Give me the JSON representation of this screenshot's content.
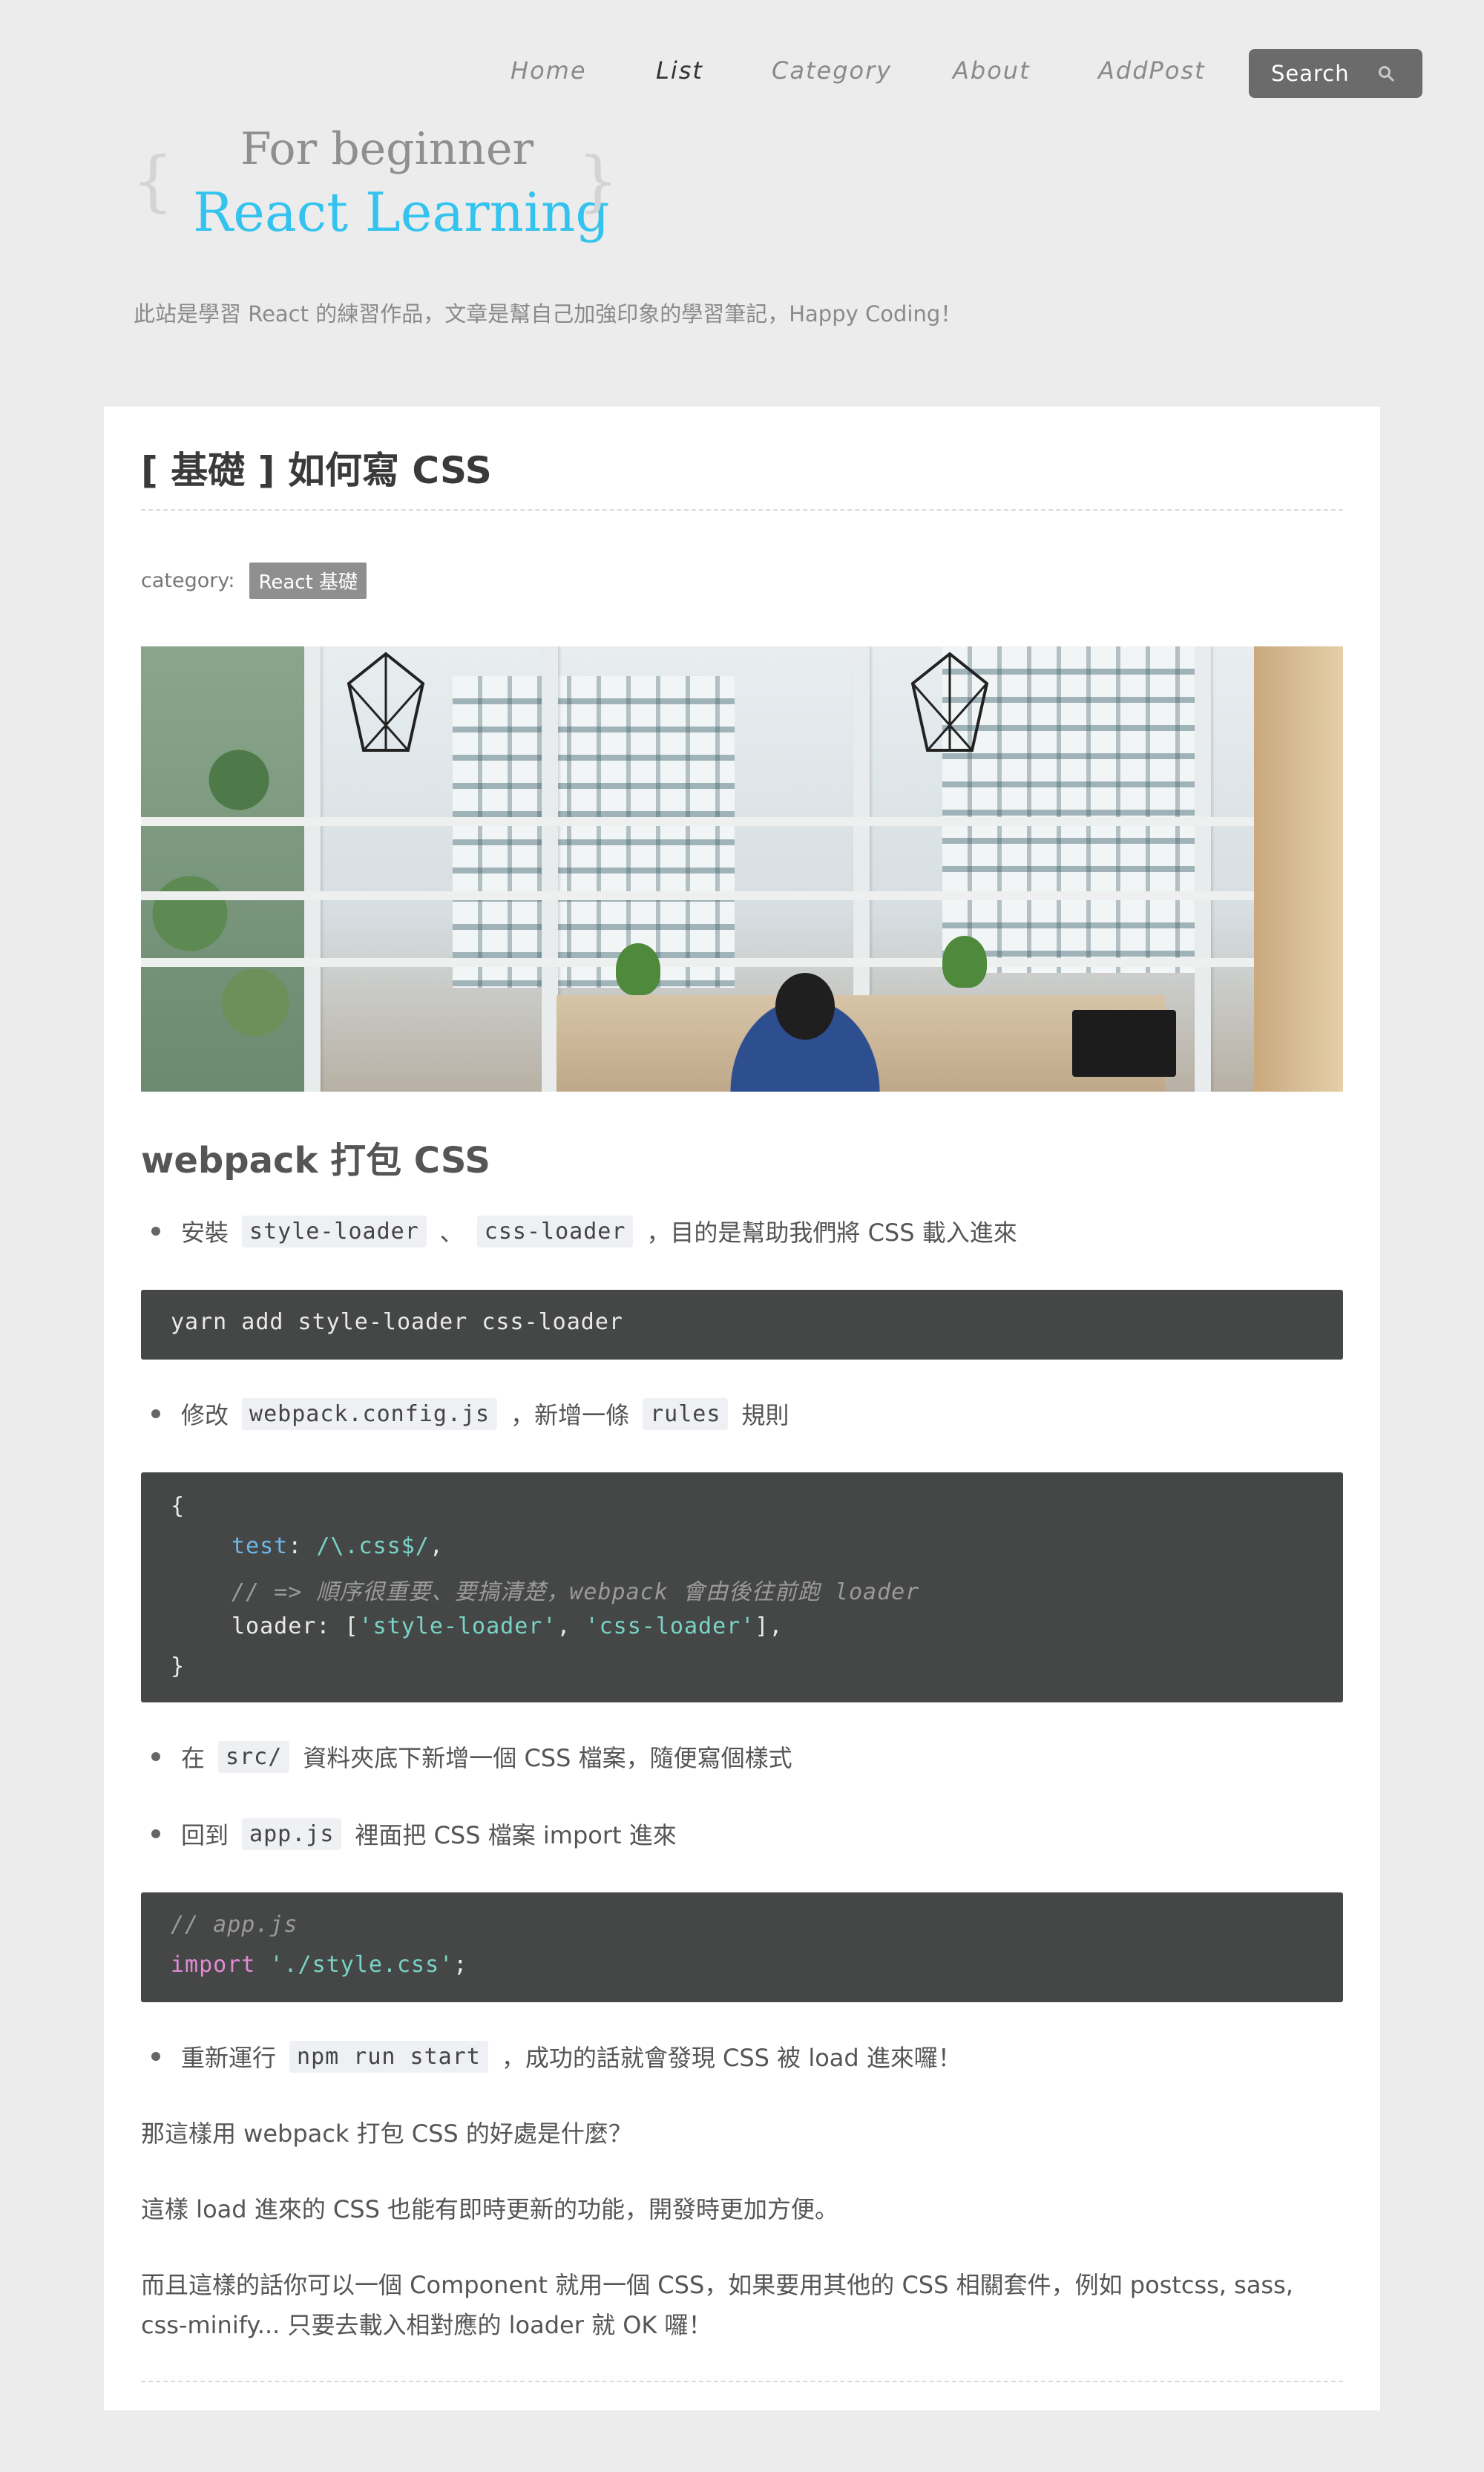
{
  "nav": {
    "items": [
      "Home",
      "List",
      "Category",
      "About",
      "AddPost"
    ],
    "active": "List",
    "search_label": "Search"
  },
  "logo": {
    "subtitle": "For beginner",
    "title": "React Learning",
    "brace_open": "{",
    "brace_close": "}"
  },
  "tagline": "此站是學習 React 的練習作品，文章是幫自己加強印象的學習筆記，Happy Coding！",
  "post": {
    "title": "[ 基礎 ] 如何寫 CSS",
    "category_label": "category:",
    "category": "React 基礎",
    "section_heading": "webpack 打包 CSS",
    "bullet1": {
      "pre": "安裝",
      "code1": "style-loader",
      "mid": "、",
      "code2": "css-loader",
      "post": "，目的是幫助我們將 CSS 載入進來"
    },
    "code1": "yarn add style-loader css-loader",
    "bullet2": {
      "pre": "修改",
      "code1": "webpack.config.js",
      "mid": "，新增一條",
      "code2": "rules",
      "post": "規則"
    },
    "code2": {
      "open": "{",
      "test_key": "test",
      "colon": ": ",
      "test_val": "/\\.css$/",
      "comma": ",",
      "comment": "// => 順序很重要、要搞清楚，webpack 會由後往前跑 loader",
      "loader_key": "loader",
      "loader_open": ": [",
      "loader_v1": "'style-loader'",
      "loader_sep": ", ",
      "loader_v2": "'css-loader'",
      "loader_close": "],",
      "close": "}"
    },
    "bullet3": {
      "pre": "在",
      "code1": "src/",
      "post": "資料夾底下新增一個 CSS 檔案，隨便寫個樣式"
    },
    "bullet4": {
      "pre": "回到",
      "code1": "app.js",
      "post": "裡面把 CSS 檔案 import 進來"
    },
    "code3": {
      "comment": "// app.js",
      "import_kw": "import",
      "import_val": "'./style.css'",
      "semi": ";"
    },
    "bullet5": {
      "pre": "重新運行",
      "code1": "npm run start",
      "post": "，成功的話就會發現 CSS 被 load 進來囉！"
    },
    "para1": "那這樣用 webpack 打包 CSS 的好處是什麼？",
    "para2": "這樣 load 進來的 CSS 也能有即時更新的功能，開發時更加方便。",
    "para3": "而且這樣的話你可以一個 Component 就用一個 CSS，如果要用其他的 CSS 相關套件，例如 postcss, sass, css-minify... 只要去載入相對應的 loader 就 OK 囉！"
  }
}
